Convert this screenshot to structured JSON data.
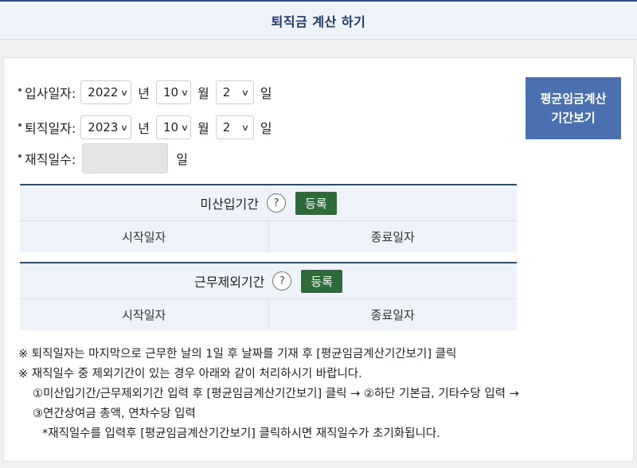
{
  "header": {
    "title": "퇴직금 계산 하기"
  },
  "hire_date": {
    "label": "입사일자:",
    "year": "2022",
    "year_unit": "년",
    "month": "10",
    "month_unit": "월",
    "day": "2",
    "day_unit": "일"
  },
  "retire_date": {
    "label": "퇴직일자:",
    "year": "2023",
    "year_unit": "년",
    "month": "10",
    "month_unit": "월",
    "day": "2",
    "day_unit": "일"
  },
  "service_days": {
    "label": "재직일수:",
    "value": "",
    "unit": "일"
  },
  "avg_button": {
    "line1": "평균임금계산",
    "line2": "기간보기"
  },
  "unpaid_period": {
    "title": "미산입기간",
    "help": "?",
    "register_label": "등록",
    "col_start": "시작일자",
    "col_end": "종료일자"
  },
  "excluded_period": {
    "title": "근무제외기간",
    "help": "?",
    "register_label": "등록",
    "col_start": "시작일자",
    "col_end": "종료일자"
  },
  "notes": [
    "※ 퇴직일자는 마지막으로 근무한 날의 1일 후 날짜를 기재 후 [평균임금계산기간보기] 클릭",
    "※ 재직일수 중 제외기간이 있는 경우 아래와 같이 처리하시기 바랍니다.",
    "①미산입기간/근무제외기간 입력 후 [평균임금계산기간보기] 클릭 → ②하단 기본급, 기타수당 입력 →",
    "③연간상여금 총액, 연차수당 입력",
    "*재직일수를 입력후 [평균임금계산기간보기] 클릭하시면 재직일수가 초기화됩니다."
  ],
  "icons": {
    "dropdown": "chevron-down-icon",
    "help": "question-circle-icon"
  },
  "colors": {
    "header_border": "#2a4f86",
    "avg_button": "#4a70b0",
    "register_button": "#2f6a3a"
  }
}
